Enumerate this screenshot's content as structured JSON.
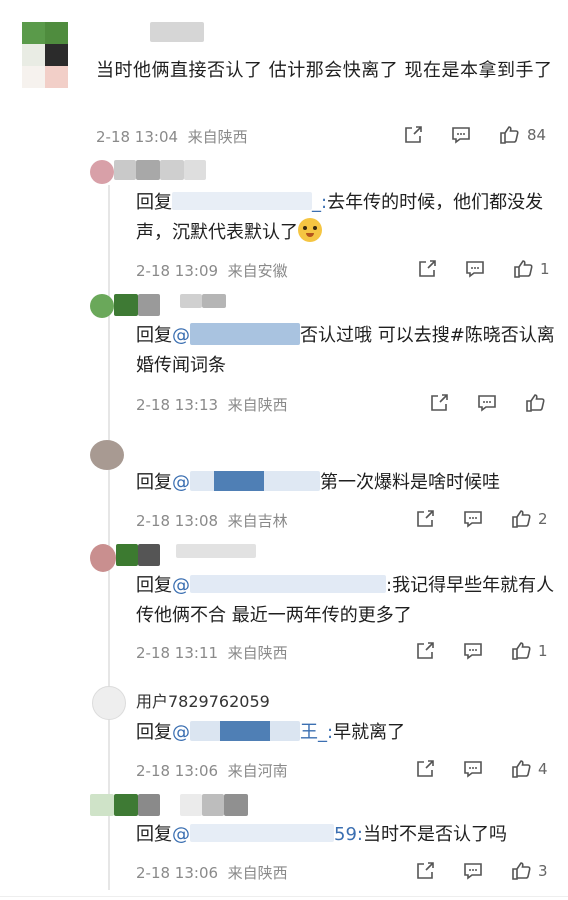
{
  "main_comment": {
    "text": "当时他俩直接否认了 估计那会快离了 现在是本拿到手了",
    "time": "2-18 13:04",
    "location": "来自陕西",
    "likes": "84"
  },
  "replies": [
    {
      "prefix": "回复",
      "mention": "",
      "mention_tail": "_:",
      "text": "去年传的时候，他们都没发声，沉默代表默认了",
      "time": "2-18 13:09",
      "location": "来自安徽",
      "likes": "1"
    },
    {
      "prefix": "回复",
      "mention": "@",
      "mention_tail": "",
      "text": "否认过哦 可以去搜#陈晓否认离婚传闻词条",
      "time": "2-18 13:13",
      "location": "来自陕西",
      "likes": ""
    },
    {
      "prefix": "回复",
      "mention": "@",
      "mention_tail": "",
      "text": "第一次爆料是啥时候哇",
      "time": "2-18 13:08",
      "location": "来自吉林",
      "likes": "2"
    },
    {
      "prefix": "回复",
      "mention": "@",
      "mention_tail": "",
      "text": ":我记得早些年就有人传他俩不合 最近一两年传的更多了",
      "time": "2-18 13:11",
      "location": "来自陕西",
      "likes": "1"
    },
    {
      "username": "用户7829762059",
      "prefix": "回复",
      "mention": "@",
      "mention_tail": "王_:",
      "text": "早就离了",
      "time": "2-18 13:06",
      "location": "来自河南",
      "likes": "4"
    },
    {
      "prefix": "回复",
      "mention": "@",
      "mention_tail": "59:",
      "text": "当时不是否认了吗",
      "time": "2-18 13:06",
      "location": "来自陕西",
      "likes": "3"
    }
  ],
  "icons": [
    "share-icon",
    "comment-icon",
    "like-icon"
  ]
}
